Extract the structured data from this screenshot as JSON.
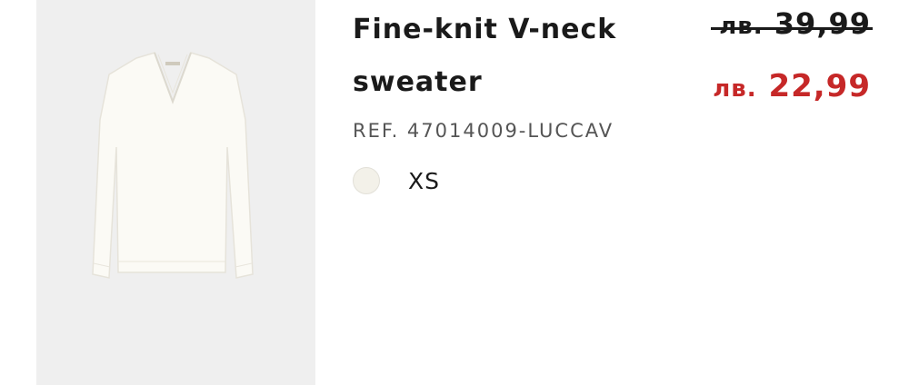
{
  "product": {
    "title": "Fine-knit V-neck sweater",
    "image_alt": "sweater",
    "reference": "REF. 47014009-LUCCAV",
    "price": {
      "old_currency": "лв.",
      "old_amount": "39,99",
      "new_currency": "лв.",
      "new_amount": "22,99",
      "sale_color": "#c62828"
    },
    "variant": {
      "swatch_color": "#f3f1e9",
      "size": "XS"
    }
  }
}
